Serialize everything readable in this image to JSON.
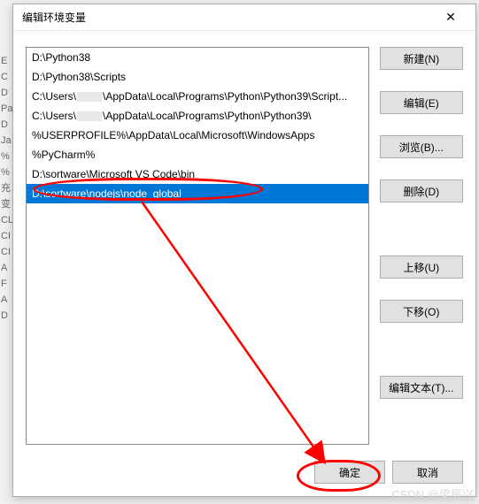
{
  "bg_letters": [
    "E",
    "C",
    "D",
    "Pa",
    "D",
    "Ja",
    "%",
    "%",
    "充",
    "变",
    "CL",
    "CI",
    "CI",
    "A",
    "F",
    "A",
    "D"
  ],
  "dialog": {
    "title": "编辑环境变量",
    "close_glyph": "✕"
  },
  "list": {
    "items": [
      "D:\\Python38",
      "D:\\Python38\\Scripts",
      "C:\\Users\\[user]\\AppData\\Local\\Programs\\Python\\Python39\\Script...",
      "C:\\Users\\[user]\\AppData\\Local\\Programs\\Python\\Python39\\",
      "%USERPROFILE%\\AppData\\Local\\Microsoft\\WindowsApps",
      "%PyCharm%",
      "D:\\sortware\\Microsoft VS Code\\bin",
      "D:\\sortware\\nodejs\\node_global"
    ],
    "selected_index": 7
  },
  "buttons": {
    "new": "新建(N)",
    "edit": "编辑(E)",
    "browse": "浏览(B)...",
    "delete": "删除(D)",
    "moveup": "上移(U)",
    "movedown": "下移(O)",
    "edittext": "编辑文本(T)...",
    "ok": "确定",
    "cancel": "取消"
  },
  "watermark": "CSDN @梁辰兴"
}
